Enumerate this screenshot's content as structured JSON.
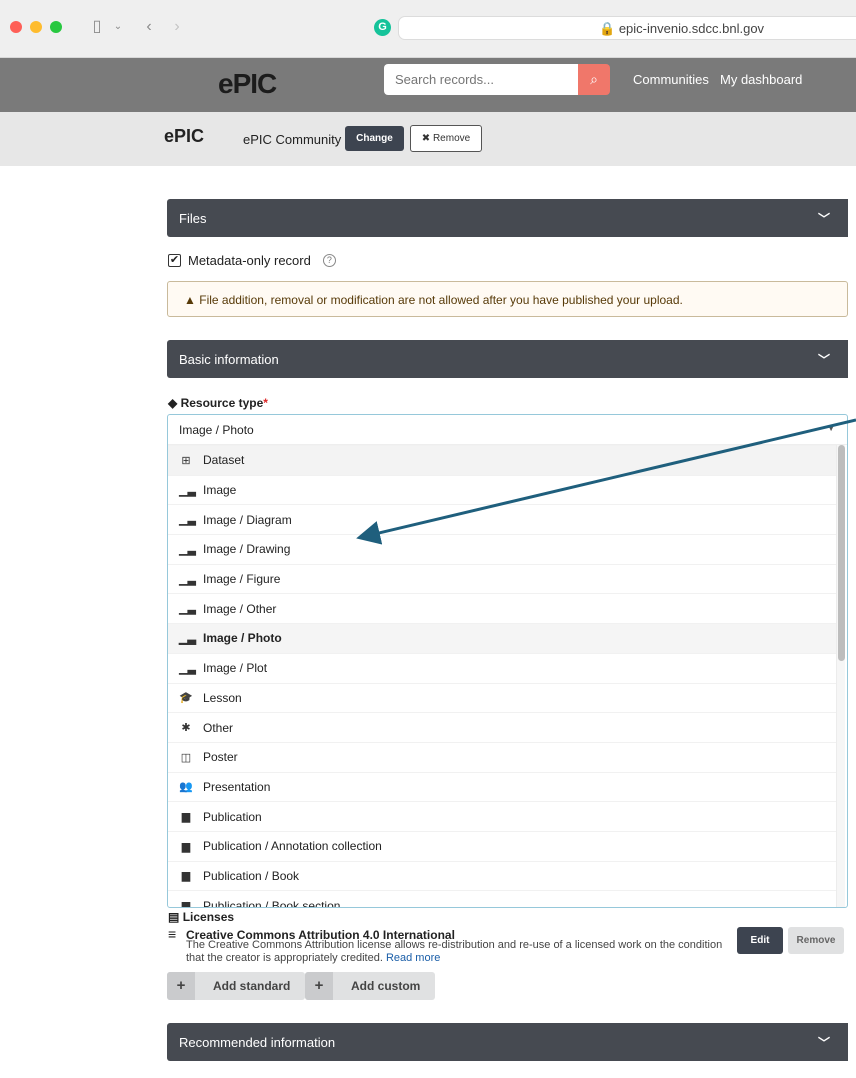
{
  "browser": {
    "url": "epic-invenio.sdcc.bnl.gov",
    "extension_letter": "G"
  },
  "header": {
    "logo_text": "ePIC",
    "search_placeholder": "Search records...",
    "nav": [
      "Communities",
      "My dashboard"
    ]
  },
  "community": {
    "logo_text": "ePIC",
    "name": "ePIC Community",
    "change_label": "Change",
    "remove_label": "✖ Remove"
  },
  "files": {
    "title": "Files",
    "metadata_only_label": "Metadata-only record",
    "metadata_only_checked": true,
    "warning": "File addition, removal or modification are not allowed after you have published your upload."
  },
  "basic_info": {
    "title": "Basic information",
    "resource_type_label": "Resource type",
    "resource_type_value": "Image / Photo",
    "options": [
      {
        "label": "Dataset",
        "icon": "table-icon"
      },
      {
        "label": "Image",
        "icon": "chart-icon"
      },
      {
        "label": "Image / Diagram",
        "icon": "chart-icon"
      },
      {
        "label": "Image / Drawing",
        "icon": "chart-icon"
      },
      {
        "label": "Image / Figure",
        "icon": "chart-icon"
      },
      {
        "label": "Image / Other",
        "icon": "chart-icon"
      },
      {
        "label": "Image / Photo",
        "icon": "chart-icon"
      },
      {
        "label": "Image / Plot",
        "icon": "chart-icon"
      },
      {
        "label": "Lesson",
        "icon": "graduation-cap-icon"
      },
      {
        "label": "Other",
        "icon": "asterisk-icon"
      },
      {
        "label": "Poster",
        "icon": "columns-icon"
      },
      {
        "label": "Presentation",
        "icon": "users-icon"
      },
      {
        "label": "Publication",
        "icon": "file-icon"
      },
      {
        "label": "Publication / Annotation collection",
        "icon": "file-icon"
      },
      {
        "label": "Publication / Book",
        "icon": "file-icon"
      },
      {
        "label": "Publication / Book section",
        "icon": "file-icon"
      }
    ]
  },
  "licenses": {
    "label": "Licenses",
    "title": "Creative Commons Attribution 4.0 International",
    "description": "The Creative Commons Attribution license allows re-distribution and re-use of a licensed work on the condition that the creator is appropriately credited.",
    "read_more": "Read more",
    "edit_label": "Edit",
    "remove_label": "Remove",
    "add_standard": "Add standard",
    "add_custom": "Add custom"
  },
  "recommended": {
    "title": "Recommended information"
  },
  "colors": {
    "header_bg": "#7a7a7a",
    "accordion_bg": "#464a51",
    "search_button": "#f0776a",
    "annotation_arrow": "#1f5f7d"
  }
}
